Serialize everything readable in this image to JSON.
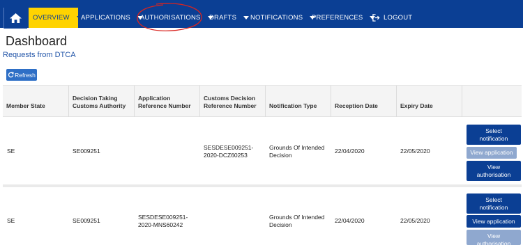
{
  "nav": {
    "home_icon": "home-icon",
    "items": [
      {
        "label": "OVERVIEW",
        "active": true
      },
      {
        "label": "APPLICATIONS"
      },
      {
        "label": "AUTHORISATIONS"
      },
      {
        "label": "DRAFTS"
      },
      {
        "label": "NOTIFICATIONS"
      },
      {
        "label": "PREFERENCES"
      },
      {
        "label": "LOGOUT"
      }
    ]
  },
  "page": {
    "title": "Dashboard",
    "subtitle": "Requests from DTCA",
    "refresh_label": "Refresh"
  },
  "table": {
    "headers": [
      "Member State",
      "Decision Taking Customs Authority",
      "Application Reference Number",
      "Customs Decision Reference Number",
      "Notification Type",
      "Reception Date",
      "Expiry Date"
    ],
    "rows": [
      {
        "member_state": "SE",
        "dtca": "SE009251",
        "app_ref": "",
        "decision_ref": "SESDESE009251-2020-DCZ60253",
        "type": "Grounds Of Intended Decision",
        "reception": "22/04/2020",
        "expiry": "22/05/2020",
        "buttons": [
          "Select notification",
          "View application",
          "View authorisation"
        ]
      },
      {
        "member_state": "SE",
        "dtca": "SE009251",
        "app_ref": "SESDESE009251-2020-MNS60242",
        "decision_ref": "",
        "type": "Grounds Of Intended Decision",
        "reception": "22/04/2020",
        "expiry": "22/05/2020",
        "buttons": [
          "Select notification",
          "View application",
          "View authorisation"
        ]
      }
    ]
  },
  "colors": {
    "nav_bg": "#0b3f94",
    "active_tab": "#ffd300",
    "annotation": "#d9241f"
  }
}
